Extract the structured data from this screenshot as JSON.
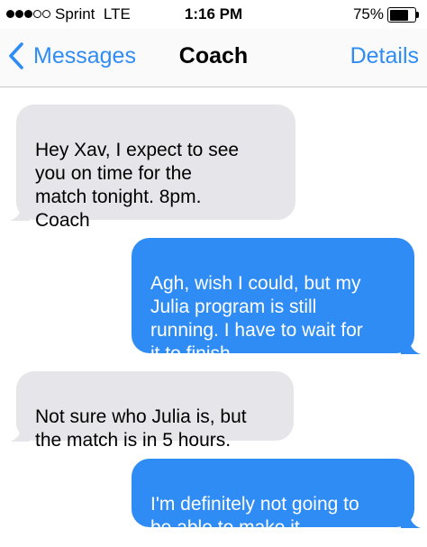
{
  "status_bar": {
    "signal_dots": [
      true,
      true,
      true,
      false,
      false
    ],
    "carrier": "Sprint",
    "network": "LTE",
    "time": "1:16 PM",
    "battery_percent_text": "75%",
    "battery_level": 0.75
  },
  "nav": {
    "back_label": "Messages",
    "title": "Coach",
    "details_label": "Details"
  },
  "colors": {
    "accent": "#2f8cf4",
    "incoming_bubble": "#e5e5ea",
    "outgoing_bubble": "#2f8cf4"
  },
  "messages": [
    {
      "direction": "incoming",
      "text": "Hey Xav, I expect to see\nyou on time for the\nmatch tonight. 8pm.\nCoach"
    },
    {
      "direction": "outgoing",
      "text": "Agh, wish I could, but my\nJulia program is still\nrunning. I have to wait for\nit to finish..."
    },
    {
      "direction": "incoming",
      "text": "Not sure who Julia is, but\nthe match is in 5 hours."
    },
    {
      "direction": "outgoing",
      "text": "I'm definitely not going to\nbe able to make it"
    }
  ]
}
